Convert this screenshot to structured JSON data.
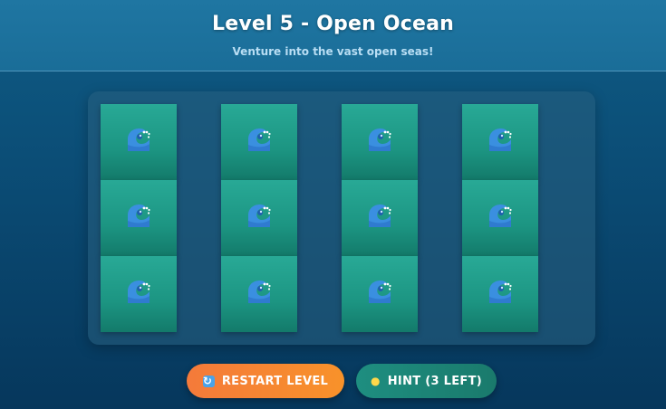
{
  "header": {
    "title": "Level 5 - Open Ocean",
    "subtitle": "Venture into the vast open seas!"
  },
  "board": {
    "columns": 4,
    "rows": 3,
    "tiles": [
      {
        "icon": "wave-icon",
        "state": "face-down"
      },
      {
        "icon": "wave-icon",
        "state": "face-down"
      },
      {
        "icon": "wave-icon",
        "state": "face-down"
      },
      {
        "icon": "wave-icon",
        "state": "face-down"
      },
      {
        "icon": "wave-icon",
        "state": "face-down"
      },
      {
        "icon": "wave-icon",
        "state": "face-down"
      },
      {
        "icon": "wave-icon",
        "state": "face-down"
      },
      {
        "icon": "wave-icon",
        "state": "face-down"
      },
      {
        "icon": "wave-icon",
        "state": "face-down"
      },
      {
        "icon": "wave-icon",
        "state": "face-down"
      },
      {
        "icon": "wave-icon",
        "state": "face-down"
      },
      {
        "icon": "wave-icon",
        "state": "face-down"
      }
    ]
  },
  "controls": {
    "restart_icon": "restart-icon",
    "restart_label": "RESTART LEVEL",
    "hint_icon": "lightbulb-icon",
    "hint_label": "HINT (3 LEFT)"
  },
  "colors": {
    "background": "#0b4d76",
    "header": "#1f76a2",
    "tile": "#1c9582",
    "restart_button": "#f8922a",
    "hint_button": "#1e8e80"
  }
}
